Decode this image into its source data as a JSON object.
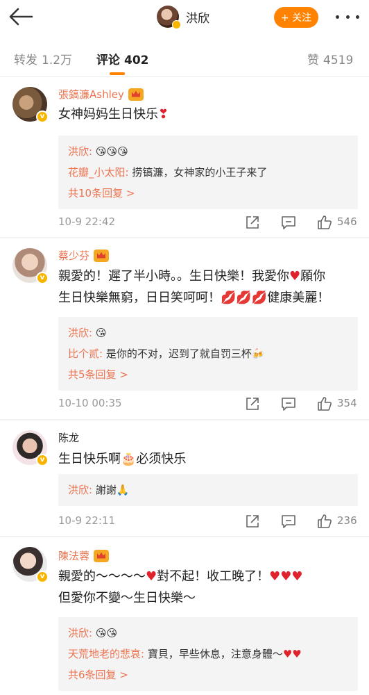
{
  "header": {
    "author_name": "洪欣",
    "follow_label": "+ 关注",
    "icons": [
      "back-arrow-icon",
      "more-icon"
    ]
  },
  "tabs": {
    "repost": {
      "label": "转发",
      "count": "1.2万"
    },
    "comments": {
      "label": "评论",
      "count": "402"
    },
    "likes": {
      "label": "赞",
      "count": "4519"
    }
  },
  "comments": [
    {
      "name": "張鎬濂Ashley",
      "text": "女神妈妈生日快乐",
      "replies": [
        {
          "user": "洪欣:",
          "text": ""
        },
        {
          "user": "花瓣_小太阳:",
          "text": "捞镐濂，女神家的小王子来了"
        }
      ],
      "more_replies": "共10条回复 >",
      "time": "10-9 22:42",
      "likes": "546"
    },
    {
      "name": "蔡少芬",
      "text_line1": "親愛的！遲了半小時。。生日快樂！我愛你",
      "text_line1b": "願你",
      "text_line2": "生日快樂無窮，日日笑呵呵！",
      "text_line2b": "健康美麗！",
      "replies": [
        {
          "user": "洪欣:",
          "text": ""
        },
        {
          "user": "比个贰:",
          "text": "是你的不对，迟到了就自罚三杯"
        }
      ],
      "more_replies": "共5条回复 >",
      "time": "10-10 00:35",
      "likes": "354"
    },
    {
      "name": "陈龙",
      "text": "生日快乐啊",
      "text_b": "必须快乐",
      "replies": [
        {
          "user": "洪欣:",
          "text": "謝謝"
        }
      ],
      "time": "10-9 22:11",
      "likes": "236"
    },
    {
      "name": "陳法蓉",
      "text_line1": "親愛的～～～～",
      "text_line1b": "對不起！收工晚了！",
      "text_line2": "但愛你不變～生日快樂～",
      "replies": [
        {
          "user": "洪欣:",
          "text": ""
        },
        {
          "user": "天荒地老的悲哀:",
          "text": "寶貝，早些休息，注意身體～"
        }
      ],
      "more_replies": "共6条回复 >"
    }
  ],
  "colors": {
    "accent": "#ff8200",
    "username": "#eb7350",
    "heart": "#e0222c"
  }
}
